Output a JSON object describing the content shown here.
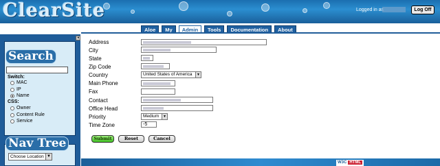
{
  "header": {
    "logo": "ClearSite",
    "logged_in_label": "Logged in as",
    "logoff_label": "Log Off"
  },
  "tabs": [
    {
      "label": "Aloe",
      "active": false
    },
    {
      "label": "My",
      "active": false
    },
    {
      "label": "Admin",
      "active": true
    },
    {
      "label": "Tools",
      "active": false
    },
    {
      "label": "Documentation",
      "active": false
    },
    {
      "label": "About",
      "active": false
    }
  ],
  "sidebar": {
    "search_title": "Search",
    "switch_label": "Switch:",
    "switch_options": [
      "MAC",
      "IP",
      "Name"
    ],
    "switch_selected": "Name",
    "css_label": "CSS:",
    "css_options": [
      "Owner",
      "Content Rule",
      "Service"
    ],
    "nav_title": "Nav Tree",
    "nav_select_value": "Choose Location",
    "collapse_glyph": "◂"
  },
  "form": {
    "labels": {
      "address": "Address",
      "city": "City",
      "state": "State",
      "zip": "Zip Code",
      "country": "Country",
      "main_phone": "Main Phone",
      "fax": "Fax",
      "contact": "Contact",
      "office_head": "Office Head",
      "priority": "Priority",
      "time_zone": "Time Zone"
    },
    "country_value": "United States of America",
    "priority_value": "Medium",
    "time_zone_value": "-5"
  },
  "buttons": {
    "submit": "Submit",
    "reset": "Reset",
    "cancel": "Cancel"
  },
  "footer": {
    "badge_prefix": "W3C",
    "badge_html": "HTML"
  },
  "colors": {
    "brand_blue": "#1f5c99",
    "submit_green": "#3fbf22"
  }
}
